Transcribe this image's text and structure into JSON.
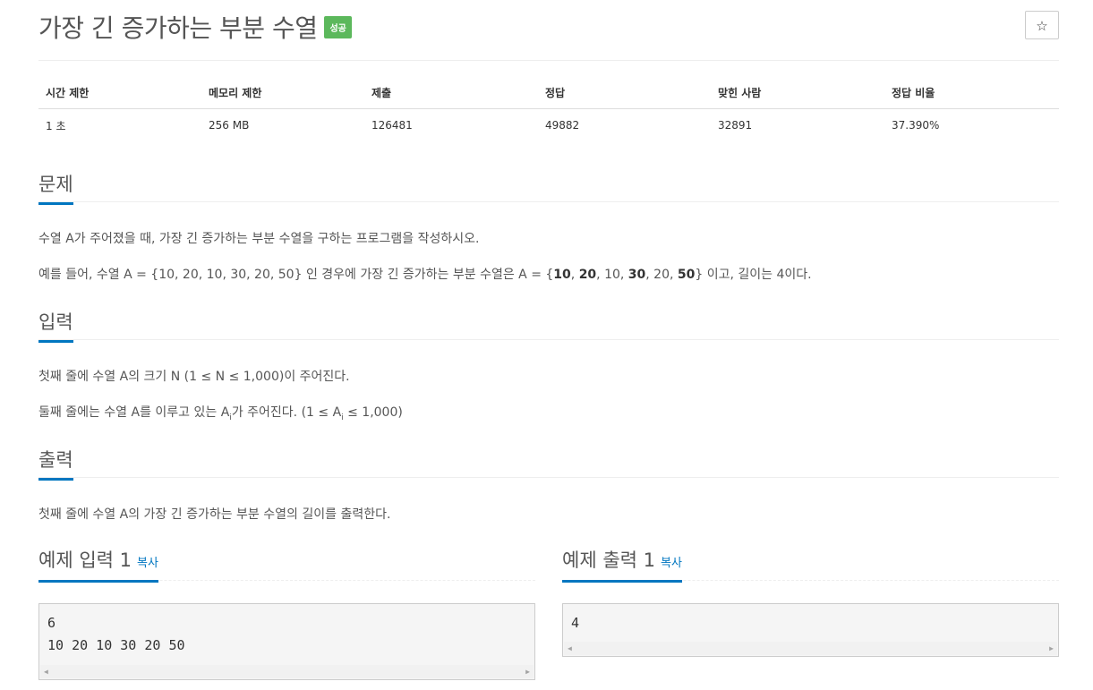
{
  "problem": {
    "title": "가장 긴 증가하는 부분 수열",
    "badge": "성공",
    "star_icon": "☆"
  },
  "info_table": {
    "headers": [
      "시간 제한",
      "메모리 제한",
      "제출",
      "정답",
      "맞힌 사람",
      "정답 비율"
    ],
    "values": [
      "1 초",
      "256 MB",
      "126481",
      "49882",
      "32891",
      "37.390%"
    ]
  },
  "sections": {
    "problem_heading": "문제",
    "problem_p1": "수열 A가 주어졌을 때, 가장 긴 증가하는 부분 수열을 구하는 프로그램을 작성하시오.",
    "problem_p2_prefix": "예를 들어, 수열 A = {10, 20, 10, 30, 20, 50} 인 경우에 가장 긴 증가하는 부분 수열은 A = {",
    "p2_b1": "10",
    "p2_s1": ", ",
    "p2_b2": "20",
    "p2_s2": ", 10, ",
    "p2_b3": "30",
    "p2_s3": ", 20, ",
    "p2_b4": "50",
    "problem_p2_suffix": "} 이고, 길이는 4이다.",
    "input_heading": "입력",
    "input_p1": "첫째 줄에 수열 A의 크기 N (1 ≤ N ≤ 1,000)이 주어진다.",
    "input_p2_a": "둘째 줄에는 수열 A를 이루고 있는 A",
    "input_p2_sub": "i",
    "input_p2_b": "가 주어진다. (1 ≤ A",
    "input_p2_sub2": "i",
    "input_p2_c": " ≤ 1,000)",
    "output_heading": "출력",
    "output_p1": "첫째 줄에 수열 A의 가장 긴 증가하는 부분 수열의 길이를 출력한다."
  },
  "examples": {
    "input_heading": "예제 입력 1",
    "output_heading": "예제 출력 1",
    "copy_label": "복사",
    "input_lines": [
      "6",
      "10 20 10 30 20 50"
    ],
    "output_lines": [
      "4"
    ]
  }
}
